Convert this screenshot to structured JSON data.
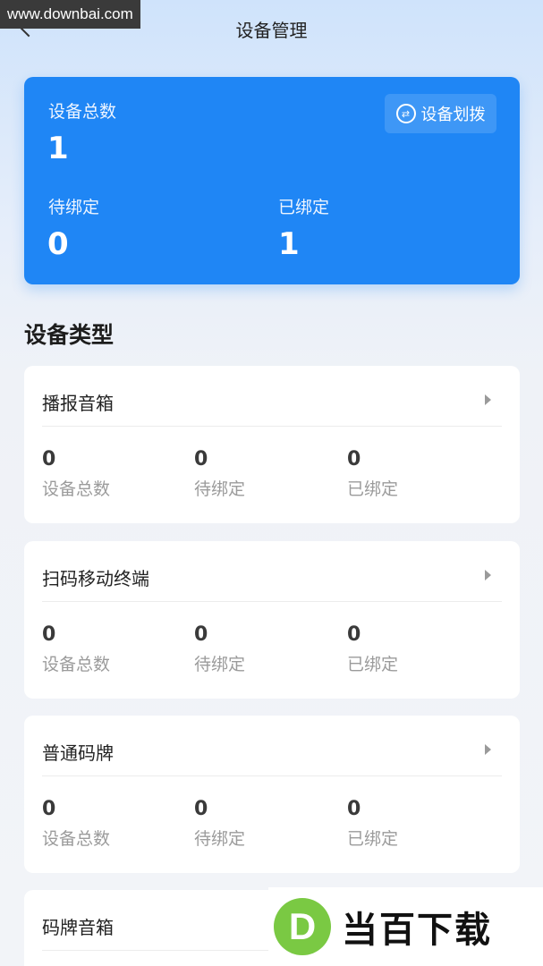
{
  "watermark": {
    "site": "www.downbai.com",
    "logo_letter": "D",
    "logo_text": "当百下载"
  },
  "header": {
    "title": "设备管理"
  },
  "summary": {
    "total_label": "设备总数",
    "total_value": "1",
    "transfer_button": "设备划拨",
    "pending_label": "待绑定",
    "pending_value": "0",
    "bound_label": "已绑定",
    "bound_value": "1"
  },
  "section": {
    "title": "设备类型"
  },
  "device_types": [
    {
      "name": "播报音箱",
      "stats": [
        {
          "value": "0",
          "label": "设备总数"
        },
        {
          "value": "0",
          "label": "待绑定"
        },
        {
          "value": "0",
          "label": "已绑定"
        }
      ]
    },
    {
      "name": "扫码移动终端",
      "stats": [
        {
          "value": "0",
          "label": "设备总数"
        },
        {
          "value": "0",
          "label": "待绑定"
        },
        {
          "value": "0",
          "label": "已绑定"
        }
      ]
    },
    {
      "name": "普通码牌",
      "stats": [
        {
          "value": "0",
          "label": "设备总数"
        },
        {
          "value": "0",
          "label": "待绑定"
        },
        {
          "value": "0",
          "label": "已绑定"
        }
      ]
    },
    {
      "name": "码牌音箱",
      "stats": []
    }
  ],
  "colors": {
    "accent": "#1f86f5",
    "logo_green": "#7ac943"
  }
}
